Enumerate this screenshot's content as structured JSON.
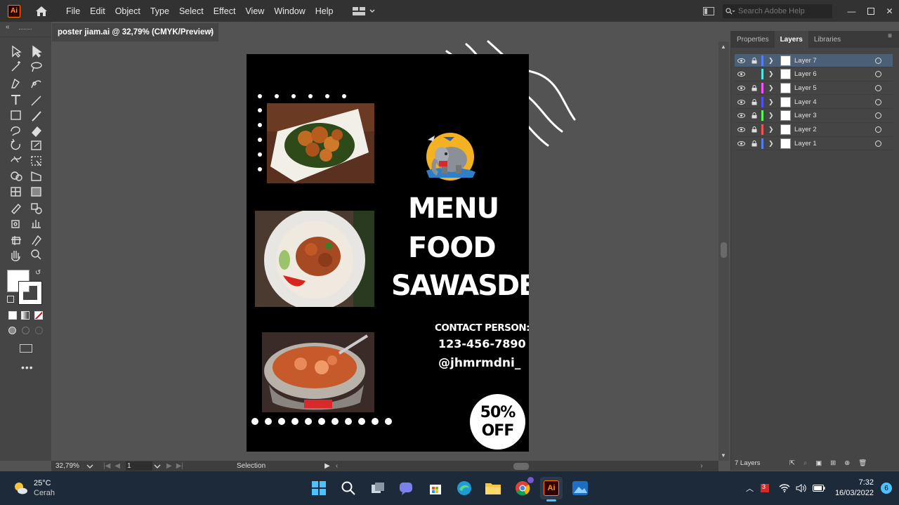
{
  "app": {
    "logo": "Ai",
    "menus": [
      "File",
      "Edit",
      "Object",
      "Type",
      "Select",
      "Effect",
      "View",
      "Window",
      "Help"
    ],
    "search_placeholder": "Search Adobe Help"
  },
  "document": {
    "tab_title": "poster jiam.ai @ 32,79% (CMYK/Preview)",
    "close_glyph": "×"
  },
  "poster": {
    "title_lines": [
      "MENU",
      "FOOD",
      "SAWASDEE"
    ],
    "contact_label": "CONTACT PERSON:",
    "phone": "123-456-7890",
    "handle": "@jhmrmdni_",
    "discount_line1": "50%",
    "discount_line2": "OFF"
  },
  "panel": {
    "tabs": [
      "Properties",
      "Layers",
      "Libraries"
    ],
    "active_tab": "Layers",
    "layers": [
      {
        "name": "Layer 7",
        "color": "#4f7fff",
        "selected": true,
        "locked": true
      },
      {
        "name": "Layer 6",
        "color": "#4fe8e8",
        "selected": false,
        "locked": false
      },
      {
        "name": "Layer 5",
        "color": "#ff4fff",
        "selected": false,
        "locked": true
      },
      {
        "name": "Layer 4",
        "color": "#4f4fff",
        "selected": false,
        "locked": true
      },
      {
        "name": "Layer 3",
        "color": "#4fff4f",
        "selected": false,
        "locked": true
      },
      {
        "name": "Layer 2",
        "color": "#ff4f4f",
        "selected": false,
        "locked": true
      },
      {
        "name": "Layer 1",
        "color": "#4f7fff",
        "selected": false,
        "locked": true
      }
    ],
    "layer_count": "7 Layers"
  },
  "status_bar": {
    "zoom": "32,79%",
    "artboard_number": "1",
    "tool_name": "Selection"
  },
  "taskbar": {
    "weather_temp": "25°C",
    "weather_text": "Cerah",
    "time": "7:32",
    "date": "16/03/2022",
    "notification_count": "6",
    "badge_count": "3"
  },
  "icons": [
    "home-icon",
    "workspace-switcher-icon",
    "search-icon",
    "minimize-icon",
    "maximize-icon",
    "close-icon",
    "eye-icon",
    "lock-icon",
    "chevron-right-icon",
    "target-circle-icon",
    "windows-start-icon",
    "taskbar-search-icon",
    "task-view-icon",
    "chat-icon",
    "store-icon",
    "edge-icon",
    "explorer-icon",
    "chrome-icon",
    "illustrator-icon",
    "photos-icon",
    "wifi-icon",
    "volume-icon",
    "battery-icon"
  ]
}
